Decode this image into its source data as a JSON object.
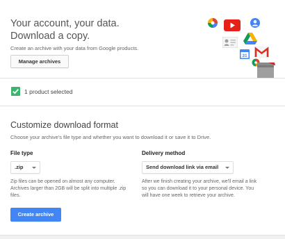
{
  "hero": {
    "title_line1": "Your account, your data.",
    "title_line2": "Download a copy.",
    "subtitle": "Create an archive with your data from Google products.",
    "manage_label": "Manage archives",
    "product_icons": [
      "photos-icon",
      "youtube-icon",
      "profile-icon",
      "drive-icon",
      "contacts-icon",
      "calendar-icon",
      "gmail-icon",
      "hangouts-icon",
      "archive-box-icon"
    ],
    "colors": {
      "youtube": "#e62117",
      "gmail": "#d93025",
      "drive_green": "#0f9d58",
      "drive_yellow": "#f4b400",
      "drive_blue": "#4285f4"
    }
  },
  "selection": {
    "label": "1 product selected",
    "checked": true,
    "color": "#3eb370"
  },
  "customize": {
    "title": "Customize download format",
    "subtitle": "Choose your archive's file type and whether you want to download it or save it to Drive.",
    "file_type": {
      "heading": "File type",
      "value": ".zip",
      "desc_lines": [
        "Zip files can be opened on almost any computer.",
        "Archives larger than 2GB will be split into multiple .zip",
        "files."
      ]
    },
    "delivery": {
      "heading": "Delivery method",
      "value": "Send download link via email",
      "desc_lines": [
        "After we finish creating your archive, we'll email a link",
        "so you can download it to your personal device. You",
        "will have one week to retrieve your archive."
      ]
    },
    "create_label": "Create archive",
    "accent": "#4285f4"
  }
}
